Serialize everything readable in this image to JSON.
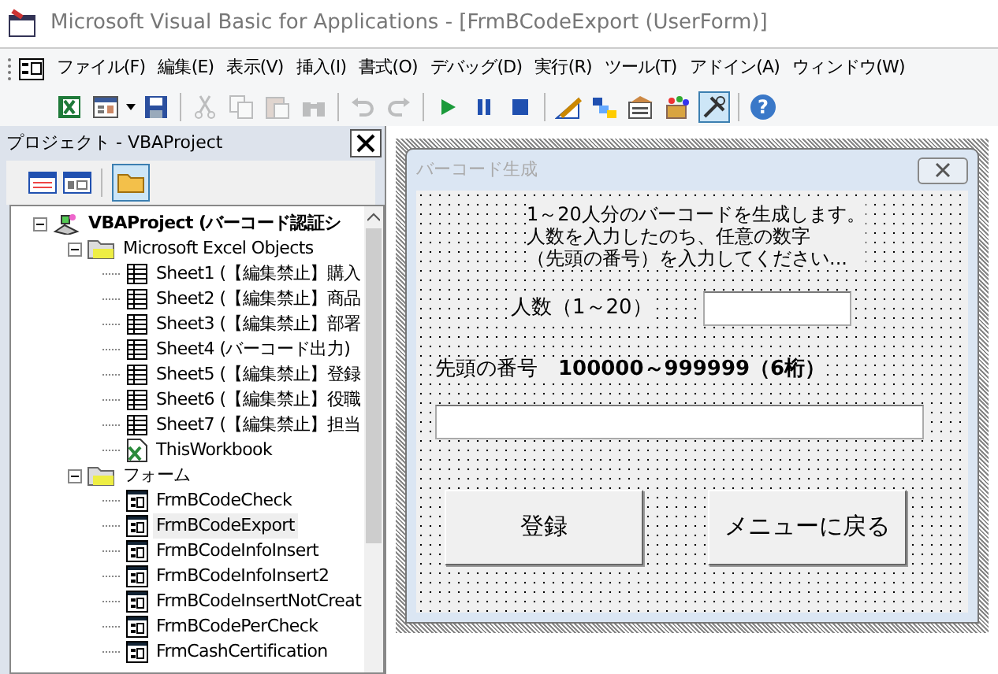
{
  "window": {
    "title": "Microsoft Visual Basic for Applications - [FrmBCodeExport (UserForm)]"
  },
  "menu": [
    "ファイル(F)",
    "編集(E)",
    "表示(V)",
    "挿入(I)",
    "書式(O)",
    "デバッグ(D)",
    "実行(R)",
    "ツール(T)",
    "アドイン(A)",
    "ウィンドウ(W)"
  ],
  "toolbar": [
    {
      "kind": "excel",
      "disabled": false
    },
    {
      "kind": "insert-form",
      "disabled": false
    },
    {
      "kind": "save",
      "disabled": false
    },
    {
      "kind": "cut",
      "disabled": true
    },
    {
      "kind": "copy",
      "disabled": true
    },
    {
      "kind": "paste",
      "disabled": true
    },
    {
      "kind": "find",
      "disabled": true
    },
    {
      "kind": "undo",
      "disabled": true
    },
    {
      "kind": "redo",
      "disabled": true
    },
    {
      "kind": "run",
      "disabled": false
    },
    {
      "kind": "pause",
      "disabled": false
    },
    {
      "kind": "stop",
      "disabled": false
    },
    {
      "kind": "design",
      "disabled": false,
      "selected": false
    },
    {
      "kind": "explorer",
      "disabled": false
    },
    {
      "kind": "properties",
      "disabled": false
    },
    {
      "kind": "browser",
      "disabled": false
    },
    {
      "kind": "toolbox",
      "disabled": false,
      "selected": true
    },
    {
      "kind": "help",
      "disabled": false,
      "glyph": "?"
    }
  ],
  "project_explorer": {
    "title": "プロジェクト - VBAProject",
    "tree": [
      {
        "kind": "project",
        "label": "VBAProject (バーコード認証シ",
        "expanded": true,
        "children": [
          {
            "kind": "folder",
            "label": "Microsoft Excel Objects",
            "expanded": true,
            "children": [
              {
                "kind": "sheet",
                "label": "Sheet1 (【編集禁止】購入"
              },
              {
                "kind": "sheet",
                "label": "Sheet2 (【編集禁止】商品"
              },
              {
                "kind": "sheet",
                "label": "Sheet3 (【編集禁止】部署"
              },
              {
                "kind": "sheet",
                "label": "Sheet4 (バーコード出力)"
              },
              {
                "kind": "sheet",
                "label": "Sheet5 (【編集禁止】登録"
              },
              {
                "kind": "sheet",
                "label": "Sheet6 (【編集禁止】役職"
              },
              {
                "kind": "sheet",
                "label": "Sheet7 (【編集禁止】担当"
              },
              {
                "kind": "workbook",
                "label": "ThisWorkbook"
              }
            ]
          },
          {
            "kind": "folder",
            "label": "フォーム",
            "expanded": true,
            "children": [
              {
                "kind": "form",
                "label": "FrmBCodeCheck",
                "selected": false
              },
              {
                "kind": "form",
                "label": "FrmBCodeExport",
                "selected": true
              },
              {
                "kind": "form",
                "label": "FrmBCodeInfoInsert",
                "selected": false
              },
              {
                "kind": "form",
                "label": "FrmBCodeInfoInsert2",
                "selected": false
              },
              {
                "kind": "form",
                "label": "FrmBCodeInsertNotCreat",
                "selected": false
              },
              {
                "kind": "form",
                "label": "FrmBCodePerCheck",
                "selected": false
              },
              {
                "kind": "form",
                "label": "FrmCashCertification",
                "selected": false
              }
            ]
          }
        ]
      }
    ]
  },
  "userform": {
    "title": "バーコード生成",
    "description": [
      "1～20人分のバーコードを生成します。",
      "人数を入力したのち、任意の数字",
      "（先頭の番号）を入力してください..."
    ],
    "count_label": "人数（1～20）",
    "start_label": "先頭の番号　**100000～999999（6桁）**",
    "buttons": [
      "登録",
      "メニューに戻る"
    ]
  }
}
